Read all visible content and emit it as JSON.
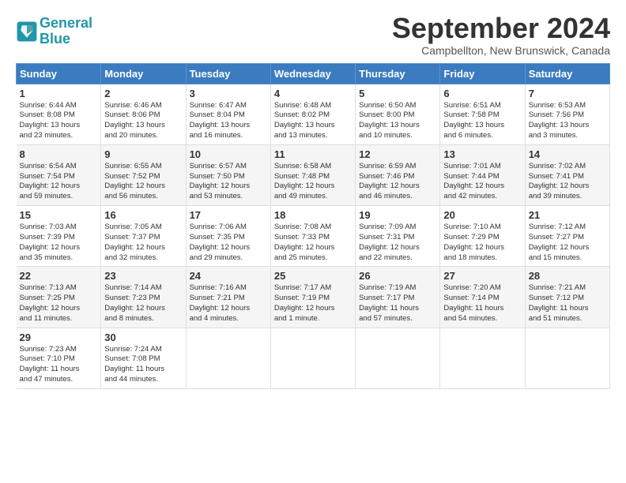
{
  "header": {
    "logo_line1": "General",
    "logo_line2": "Blue",
    "month": "September 2024",
    "location": "Campbellton, New Brunswick, Canada"
  },
  "weekdays": [
    "Sunday",
    "Monday",
    "Tuesday",
    "Wednesday",
    "Thursday",
    "Friday",
    "Saturday"
  ],
  "weeks": [
    [
      {
        "day": "1",
        "lines": [
          "Sunrise: 6:44 AM",
          "Sunset: 8:08 PM",
          "Daylight: 13 hours",
          "and 23 minutes."
        ]
      },
      {
        "day": "2",
        "lines": [
          "Sunrise: 6:46 AM",
          "Sunset: 8:06 PM",
          "Daylight: 13 hours",
          "and 20 minutes."
        ]
      },
      {
        "day": "3",
        "lines": [
          "Sunrise: 6:47 AM",
          "Sunset: 8:04 PM",
          "Daylight: 13 hours",
          "and 16 minutes."
        ]
      },
      {
        "day": "4",
        "lines": [
          "Sunrise: 6:48 AM",
          "Sunset: 8:02 PM",
          "Daylight: 13 hours",
          "and 13 minutes."
        ]
      },
      {
        "day": "5",
        "lines": [
          "Sunrise: 6:50 AM",
          "Sunset: 8:00 PM",
          "Daylight: 13 hours",
          "and 10 minutes."
        ]
      },
      {
        "day": "6",
        "lines": [
          "Sunrise: 6:51 AM",
          "Sunset: 7:58 PM",
          "Daylight: 13 hours",
          "and 6 minutes."
        ]
      },
      {
        "day": "7",
        "lines": [
          "Sunrise: 6:53 AM",
          "Sunset: 7:56 PM",
          "Daylight: 13 hours",
          "and 3 minutes."
        ]
      }
    ],
    [
      {
        "day": "8",
        "lines": [
          "Sunrise: 6:54 AM",
          "Sunset: 7:54 PM",
          "Daylight: 12 hours",
          "and 59 minutes."
        ]
      },
      {
        "day": "9",
        "lines": [
          "Sunrise: 6:55 AM",
          "Sunset: 7:52 PM",
          "Daylight: 12 hours",
          "and 56 minutes."
        ]
      },
      {
        "day": "10",
        "lines": [
          "Sunrise: 6:57 AM",
          "Sunset: 7:50 PM",
          "Daylight: 12 hours",
          "and 53 minutes."
        ]
      },
      {
        "day": "11",
        "lines": [
          "Sunrise: 6:58 AM",
          "Sunset: 7:48 PM",
          "Daylight: 12 hours",
          "and 49 minutes."
        ]
      },
      {
        "day": "12",
        "lines": [
          "Sunrise: 6:59 AM",
          "Sunset: 7:46 PM",
          "Daylight: 12 hours",
          "and 46 minutes."
        ]
      },
      {
        "day": "13",
        "lines": [
          "Sunrise: 7:01 AM",
          "Sunset: 7:44 PM",
          "Daylight: 12 hours",
          "and 42 minutes."
        ]
      },
      {
        "day": "14",
        "lines": [
          "Sunrise: 7:02 AM",
          "Sunset: 7:41 PM",
          "Daylight: 12 hours",
          "and 39 minutes."
        ]
      }
    ],
    [
      {
        "day": "15",
        "lines": [
          "Sunrise: 7:03 AM",
          "Sunset: 7:39 PM",
          "Daylight: 12 hours",
          "and 35 minutes."
        ]
      },
      {
        "day": "16",
        "lines": [
          "Sunrise: 7:05 AM",
          "Sunset: 7:37 PM",
          "Daylight: 12 hours",
          "and 32 minutes."
        ]
      },
      {
        "day": "17",
        "lines": [
          "Sunrise: 7:06 AM",
          "Sunset: 7:35 PM",
          "Daylight: 12 hours",
          "and 29 minutes."
        ]
      },
      {
        "day": "18",
        "lines": [
          "Sunrise: 7:08 AM",
          "Sunset: 7:33 PM",
          "Daylight: 12 hours",
          "and 25 minutes."
        ]
      },
      {
        "day": "19",
        "lines": [
          "Sunrise: 7:09 AM",
          "Sunset: 7:31 PM",
          "Daylight: 12 hours",
          "and 22 minutes."
        ]
      },
      {
        "day": "20",
        "lines": [
          "Sunrise: 7:10 AM",
          "Sunset: 7:29 PM",
          "Daylight: 12 hours",
          "and 18 minutes."
        ]
      },
      {
        "day": "21",
        "lines": [
          "Sunrise: 7:12 AM",
          "Sunset: 7:27 PM",
          "Daylight: 12 hours",
          "and 15 minutes."
        ]
      }
    ],
    [
      {
        "day": "22",
        "lines": [
          "Sunrise: 7:13 AM",
          "Sunset: 7:25 PM",
          "Daylight: 12 hours",
          "and 11 minutes."
        ]
      },
      {
        "day": "23",
        "lines": [
          "Sunrise: 7:14 AM",
          "Sunset: 7:23 PM",
          "Daylight: 12 hours",
          "and 8 minutes."
        ]
      },
      {
        "day": "24",
        "lines": [
          "Sunrise: 7:16 AM",
          "Sunset: 7:21 PM",
          "Daylight: 12 hours",
          "and 4 minutes."
        ]
      },
      {
        "day": "25",
        "lines": [
          "Sunrise: 7:17 AM",
          "Sunset: 7:19 PM",
          "Daylight: 12 hours",
          "and 1 minute."
        ]
      },
      {
        "day": "26",
        "lines": [
          "Sunrise: 7:19 AM",
          "Sunset: 7:17 PM",
          "Daylight: 11 hours",
          "and 57 minutes."
        ]
      },
      {
        "day": "27",
        "lines": [
          "Sunrise: 7:20 AM",
          "Sunset: 7:14 PM",
          "Daylight: 11 hours",
          "and 54 minutes."
        ]
      },
      {
        "day": "28",
        "lines": [
          "Sunrise: 7:21 AM",
          "Sunset: 7:12 PM",
          "Daylight: 11 hours",
          "and 51 minutes."
        ]
      }
    ],
    [
      {
        "day": "29",
        "lines": [
          "Sunrise: 7:23 AM",
          "Sunset: 7:10 PM",
          "Daylight: 11 hours",
          "and 47 minutes."
        ]
      },
      {
        "day": "30",
        "lines": [
          "Sunrise: 7:24 AM",
          "Sunset: 7:08 PM",
          "Daylight: 11 hours",
          "and 44 minutes."
        ]
      },
      {
        "day": "",
        "lines": []
      },
      {
        "day": "",
        "lines": []
      },
      {
        "day": "",
        "lines": []
      },
      {
        "day": "",
        "lines": []
      },
      {
        "day": "",
        "lines": []
      }
    ]
  ]
}
